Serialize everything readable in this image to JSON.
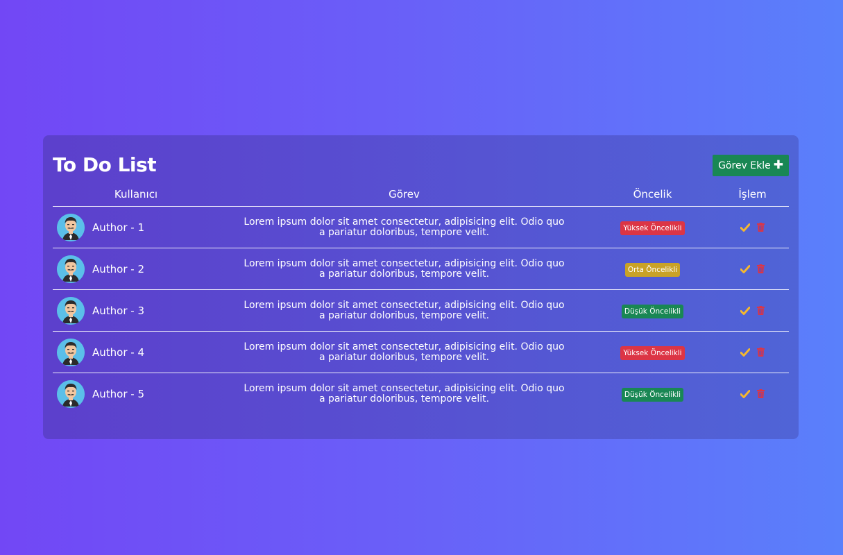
{
  "header": {
    "title": "To Do List",
    "add_button_label": "Görev Ekle",
    "add_icon": "plus-icon"
  },
  "table": {
    "columns": [
      "Kullanıcı",
      "Görev",
      "Öncelik",
      "İşlem"
    ],
    "rows": [
      {
        "author": "Author - 1",
        "task": "Lorem ipsum dolor sit amet consectetur, adipisicing elit. Odio quo a pariatur doloribus, tempore velit.",
        "priority": "Yüksek Öncelikli",
        "priority_color": "#dc3545"
      },
      {
        "author": "Author - 2",
        "task": "Lorem ipsum dolor sit amet consectetur, adipisicing elit. Odio quo a pariatur doloribus, tempore velit.",
        "priority": "Orta Öncelikli",
        "priority_color": "#c9a227"
      },
      {
        "author": "Author - 3",
        "task": "Lorem ipsum dolor sit amet consectetur, adipisicing elit. Odio quo a pariatur doloribus, tempore velit.",
        "priority": "Düşük Öncelikli",
        "priority_color": "#198754"
      },
      {
        "author": "Author - 4",
        "task": "Lorem ipsum dolor sit amet consectetur, adipisicing elit. Odio quo a pariatur doloribus, tempore velit.",
        "priority": "Yüksek Öncelikli",
        "priority_color": "#dc3545"
      },
      {
        "author": "Author - 5",
        "task": "Lorem ipsum dolor sit amet consectetur, adipisicing elit. Odio quo a pariatur doloribus, tempore velit.",
        "priority": "Düşük Öncelikli",
        "priority_color": "#198754"
      }
    ]
  },
  "colors": {
    "accent_green": "#198754",
    "check_color": "#f5b82e",
    "trash_color": "#dc3545"
  },
  "icons": {
    "avatar": "avatar-man-mustache",
    "complete": "check-icon",
    "delete": "trash-icon"
  }
}
